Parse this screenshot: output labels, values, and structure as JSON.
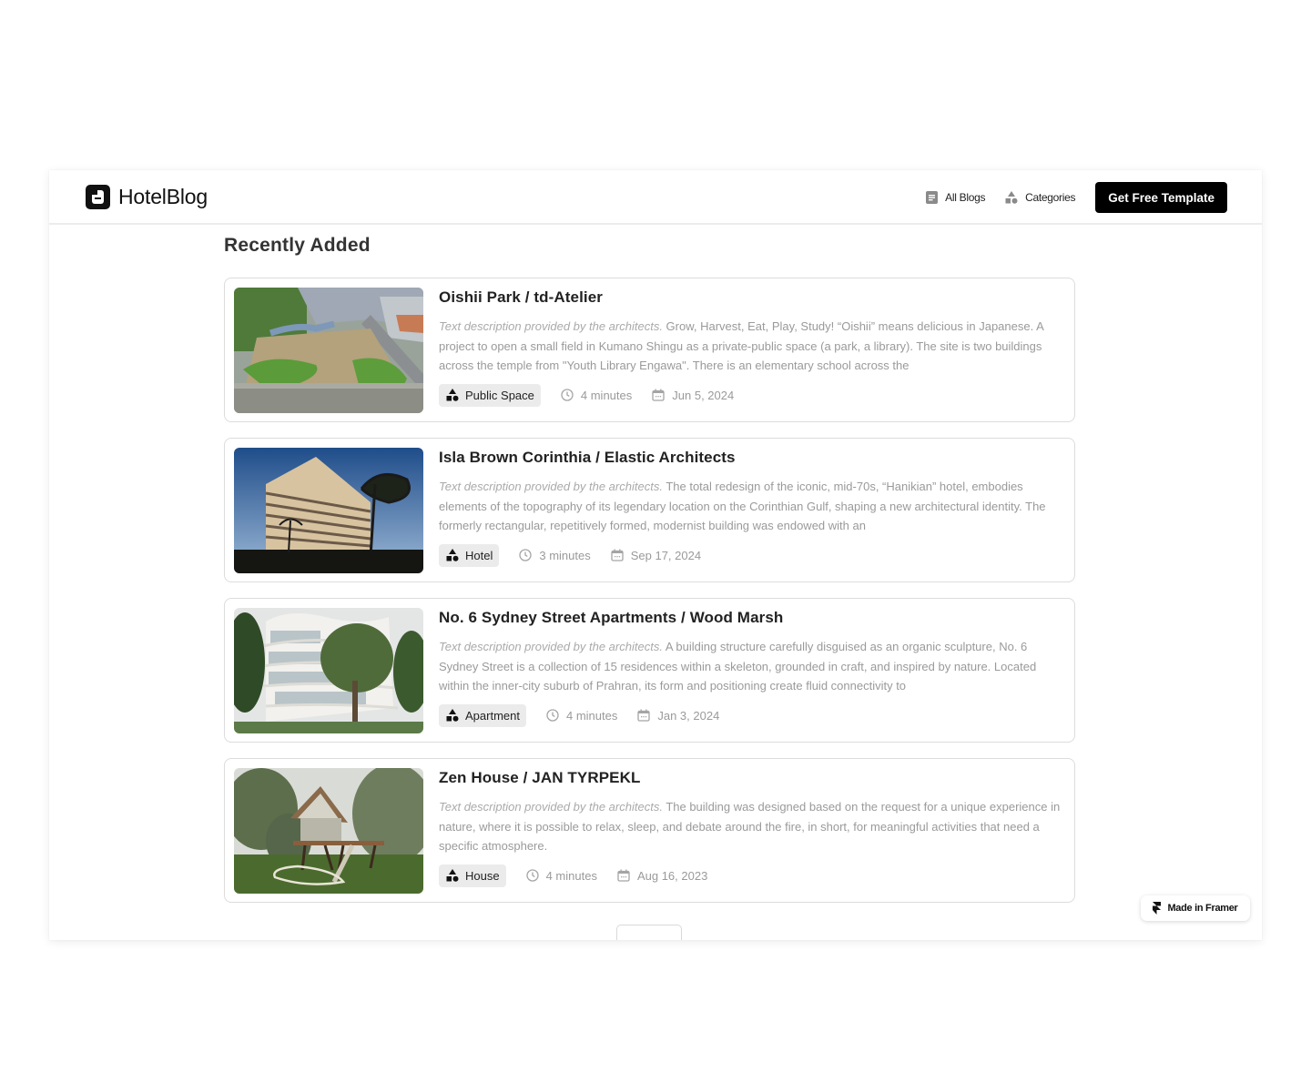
{
  "header": {
    "brand": "HotelBlog",
    "nav": [
      {
        "label": "All Blogs",
        "icon": "document-icon"
      },
      {
        "label": "Categories",
        "icon": "shapes-icon"
      }
    ],
    "cta_label": "Get Free Template"
  },
  "main": {
    "section_title": "Recently Added",
    "posts": [
      {
        "title": "Oishii Park / td-Atelier",
        "desc_lead": "Text description provided by the architects.",
        "desc_body": " Grow, Harvest, Eat, Play, Study! “Oishii” means delicious in Japanese. A project to open a small field in Kumano Shingu as a private-public space (a park, a library). The site is two buildings across the temple from \"Youth Library Engawa\". There is an elementary school across the",
        "category": "Public Space",
        "read_time": "4 minutes",
        "date": "Jun 5, 2024",
        "image_alt": "Aerial view of a garden park with a slide"
      },
      {
        "title": "Isla Brown Corinthia / Elastic Architects",
        "desc_lead": "Text description provided by the architects.",
        "desc_body": " The total redesign of the iconic, mid-70s, “Hanikian” hotel, embodies elements of the topography of its legendary location on the Corinthian Gulf, shaping a new architectural identity. The formerly rectangular, repetitively formed, modernist building was endowed with an",
        "category": "Hotel",
        "read_time": "3 minutes",
        "date": "Sep 17, 2024",
        "image_alt": "Curved hotel building at dusk with pine trees"
      },
      {
        "title": "No. 6 Sydney Street Apartments / Wood Marsh",
        "desc_lead": "Text description provided by the architects.",
        "desc_body": " A building structure carefully disguised as an organic sculpture, No. 6 Sydney Street is a collection of 15 residences within a skeleton, grounded in craft, and inspired by nature. Located within the inner-city suburb of Prahran, its form and positioning create fluid connectivity to",
        "category": "Apartment",
        "read_time": "4 minutes",
        "date": "Jan 3, 2024",
        "image_alt": "White curvy apartment building behind trees"
      },
      {
        "title": "Zen House / JAN TYRPEKL",
        "desc_lead": "Text description provided by the architects.",
        "desc_body": " The building was designed based on the request for a unique experience in nature, where it is possible to relax, sleep, and debate around the fire, in short, for meaningful activities that need a specific atmosphere.",
        "category": "House",
        "read_time": "4 minutes",
        "date": "Aug 16, 2023",
        "image_alt": "Elevated glass cabin on stilts in a meadow"
      }
    ]
  },
  "badge": {
    "label": "Made in Framer"
  },
  "colors": {
    "accent": "#000000",
    "muted_text": "#9a9a9a",
    "tag_bg": "#ebebeb",
    "border": "#dcdcdc"
  }
}
